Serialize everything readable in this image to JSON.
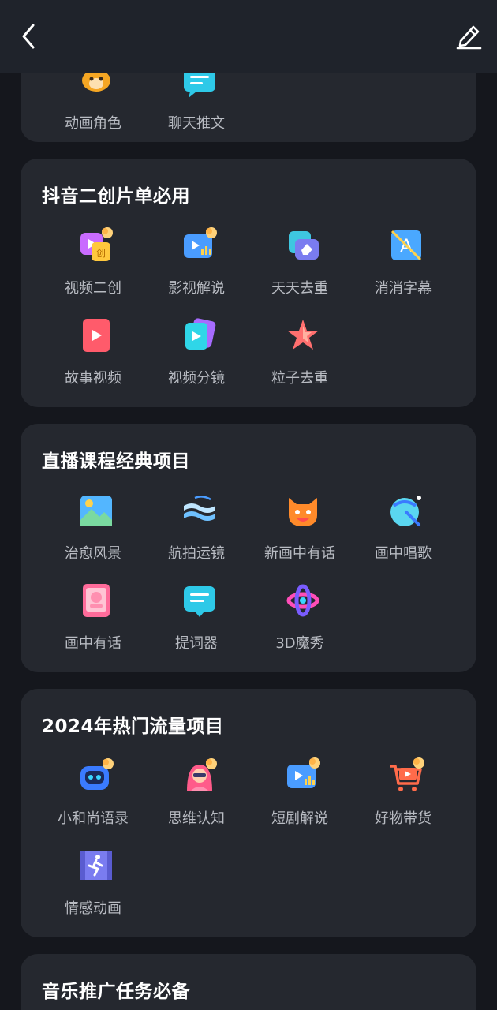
{
  "topbar": {
    "back_icon": "chevron-left-icon",
    "edit_icon": "pencil-edit-icon"
  },
  "sections": [
    {
      "title": "",
      "items": [
        {
          "label": "动画角色",
          "icon": "cartoon-character-icon"
        },
        {
          "label": "聊天推文",
          "icon": "chat-bubble-icon"
        }
      ]
    },
    {
      "title": "抖音二创片单必用",
      "items": [
        {
          "label": "视频二创",
          "icon": "video-remix-icon"
        },
        {
          "label": "影视解说",
          "icon": "film-commentary-icon"
        },
        {
          "label": "天天去重",
          "icon": "eraser-dedupe-icon"
        },
        {
          "label": "消消字幕",
          "icon": "subtitle-remove-icon"
        },
        {
          "label": "故事视频",
          "icon": "story-video-icon"
        },
        {
          "label": "视频分镜",
          "icon": "storyboard-cards-icon"
        },
        {
          "label": "粒子去重",
          "icon": "particle-star-icon"
        }
      ]
    },
    {
      "title": "直播课程经典项目",
      "items": [
        {
          "label": "治愈风景",
          "icon": "landscape-picture-icon"
        },
        {
          "label": "航拍运镜",
          "icon": "aerial-layers-icon"
        },
        {
          "label": "新画中有话",
          "icon": "cat-face-icon"
        },
        {
          "label": "画中唱歌",
          "icon": "singing-ball-icon"
        },
        {
          "label": "画中有话",
          "icon": "talking-portrait-icon"
        },
        {
          "label": "提词器",
          "icon": "teleprompter-icon"
        },
        {
          "label": "3D魔秀",
          "icon": "3d-magic-icon"
        }
      ]
    },
    {
      "title": "2024年热门流量项目",
      "items": [
        {
          "label": "小和尚语录",
          "icon": "robot-monk-icon"
        },
        {
          "label": "思维认知",
          "icon": "thinking-girl-icon"
        },
        {
          "label": "短剧解说",
          "icon": "short-drama-icon"
        },
        {
          "label": "好物带货",
          "icon": "shopping-cart-icon"
        },
        {
          "label": "情感动画",
          "icon": "running-figure-film-icon"
        }
      ]
    },
    {
      "title": "音乐推广任务必备",
      "items": []
    }
  ]
}
